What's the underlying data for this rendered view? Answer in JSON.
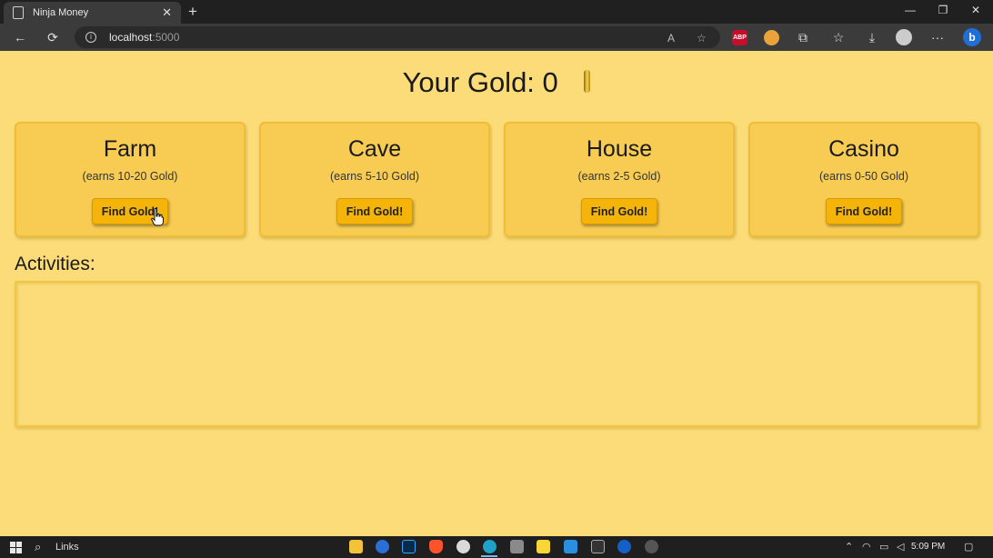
{
  "browser": {
    "tab_title": "Ninja Money",
    "tab_close": "✕",
    "new_tab": "+",
    "url_host": "localhost",
    "url_port": ":5000",
    "back": "←",
    "refresh": "⟳",
    "more": "···",
    "window_controls": {
      "minimize": "—",
      "restore": "❐",
      "close": "✕"
    },
    "extensions": [
      {
        "name": "adblock-plus-icon",
        "label": "ABP",
        "color": "#c70d2c"
      },
      {
        "name": "honey-icon",
        "label": "",
        "color": "#e8a33a"
      }
    ]
  },
  "header": {
    "label": "Your Gold:",
    "amount": "0"
  },
  "locations": [
    {
      "name": "Farm",
      "earns": "(earns 10-20 Gold)",
      "button": "Find Gold!"
    },
    {
      "name": "Cave",
      "earns": "(earns 5-10 Gold)",
      "button": "Find Gold!"
    },
    {
      "name": "House",
      "earns": "(earns 2-5 Gold)",
      "button": "Find Gold!"
    },
    {
      "name": "Casino",
      "earns": "(earns 0-50 Gold)",
      "button": "Find Gold!"
    }
  ],
  "activities": {
    "title": "Activities:",
    "entries": []
  },
  "taskbar": {
    "search_label": "Links",
    "time": "5:09 PM"
  },
  "colors": {
    "page_background": "#fbdc78",
    "card_background": "#f8cc52",
    "button_background": "#f4b409"
  }
}
